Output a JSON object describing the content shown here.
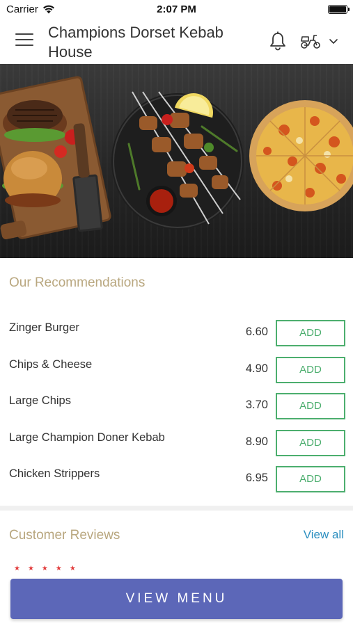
{
  "status_bar": {
    "carrier": "Carrier",
    "time": "2:07 PM"
  },
  "header": {
    "title": "Champions Dorset Kebab House"
  },
  "recommendations": {
    "title": "Our Recommendations",
    "items": [
      {
        "name": "Zinger Burger",
        "price": "6.60",
        "button": "ADD"
      },
      {
        "name": "Chips & Cheese",
        "price": "4.90",
        "button": "ADD"
      },
      {
        "name": "Large Chips",
        "price": "3.70",
        "button": "ADD"
      },
      {
        "name": "Large Champion Doner Kebab",
        "price": "8.90",
        "button": "ADD"
      },
      {
        "name": "Chicken Strippers",
        "price": "6.95",
        "button": "ADD"
      }
    ]
  },
  "reviews": {
    "title": "Customer Reviews",
    "view_all": "View all",
    "stars": "★★★★★"
  },
  "footer": {
    "view_menu": "VIEW MENU"
  },
  "colors": {
    "accent_title": "#b9a77f",
    "add_green": "#4cae6e",
    "link_blue": "#2c8fc0",
    "menu_button": "#5c67b8"
  },
  "icons": [
    "hamburger-menu-icon",
    "bell-icon",
    "scooter-icon",
    "chevron-down-icon",
    "wifi-icon",
    "battery-icon"
  ]
}
